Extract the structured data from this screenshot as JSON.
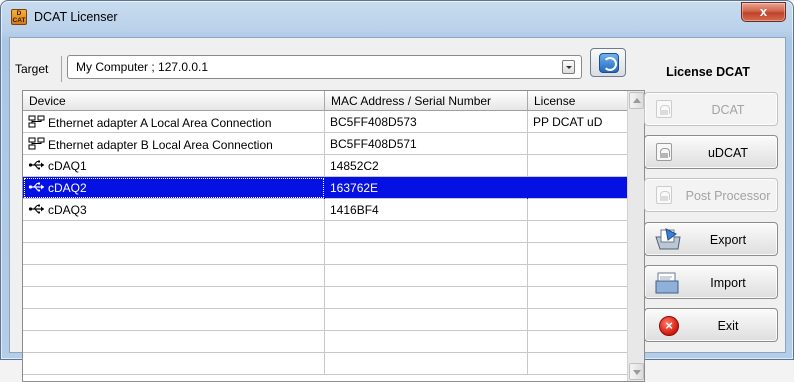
{
  "window": {
    "title": "DCAT Licenser",
    "app_icon_lines": [
      "D",
      "CAT"
    ],
    "close_glyph": "x"
  },
  "target": {
    "label": "Target",
    "value": "My Computer ; 127.0.0.1"
  },
  "license_panel": {
    "title": "License DCAT",
    "buttons": [
      {
        "label": "DCAT",
        "enabled": false,
        "icon": "lock-icon"
      },
      {
        "label": "uDCAT",
        "enabled": true,
        "icon": "lock-icon"
      },
      {
        "label": "Post Processor",
        "enabled": false,
        "icon": "lock-icon"
      },
      {
        "label": "Export",
        "enabled": true,
        "icon": "export-icon"
      },
      {
        "label": "Import",
        "enabled": true,
        "icon": "import-icon"
      },
      {
        "label": "Exit",
        "enabled": true,
        "icon": "exit-icon"
      }
    ]
  },
  "table": {
    "columns": [
      "Device",
      "MAC Address / Serial Number",
      "License"
    ],
    "rows": [
      {
        "device": "Ethernet adapter A Local Area Connection",
        "serial": "BC5FF408D573",
        "license": "PP DCAT uD",
        "icon": "network-icon",
        "selected": false
      },
      {
        "device": "Ethernet adapter B Local Area Connection",
        "serial": "BC5FF408D571",
        "license": "",
        "icon": "network-icon",
        "selected": false
      },
      {
        "device": "cDAQ1",
        "serial": "14852C2",
        "license": "",
        "icon": "usb-icon",
        "selected": false
      },
      {
        "device": "cDAQ2",
        "serial": "163762E",
        "license": "",
        "icon": "usb-icon",
        "selected": true
      },
      {
        "device": "cDAQ3",
        "serial": "1416BF4",
        "license": "",
        "icon": "usb-icon",
        "selected": false
      },
      {
        "device": "",
        "serial": "",
        "license": "",
        "icon": "",
        "selected": false
      },
      {
        "device": "",
        "serial": "",
        "license": "",
        "icon": "",
        "selected": false
      },
      {
        "device": "",
        "serial": "",
        "license": "",
        "icon": "",
        "selected": false
      },
      {
        "device": "",
        "serial": "",
        "license": "",
        "icon": "",
        "selected": false
      },
      {
        "device": "",
        "serial": "",
        "license": "",
        "icon": "",
        "selected": false
      },
      {
        "device": "",
        "serial": "",
        "license": "",
        "icon": "",
        "selected": false
      },
      {
        "device": "",
        "serial": "",
        "license": "",
        "icon": "",
        "selected": false
      }
    ]
  },
  "colors": {
    "selection": "#0511e2",
    "exit_red": "#d3170b",
    "refresh_blue": "#2468bd"
  }
}
